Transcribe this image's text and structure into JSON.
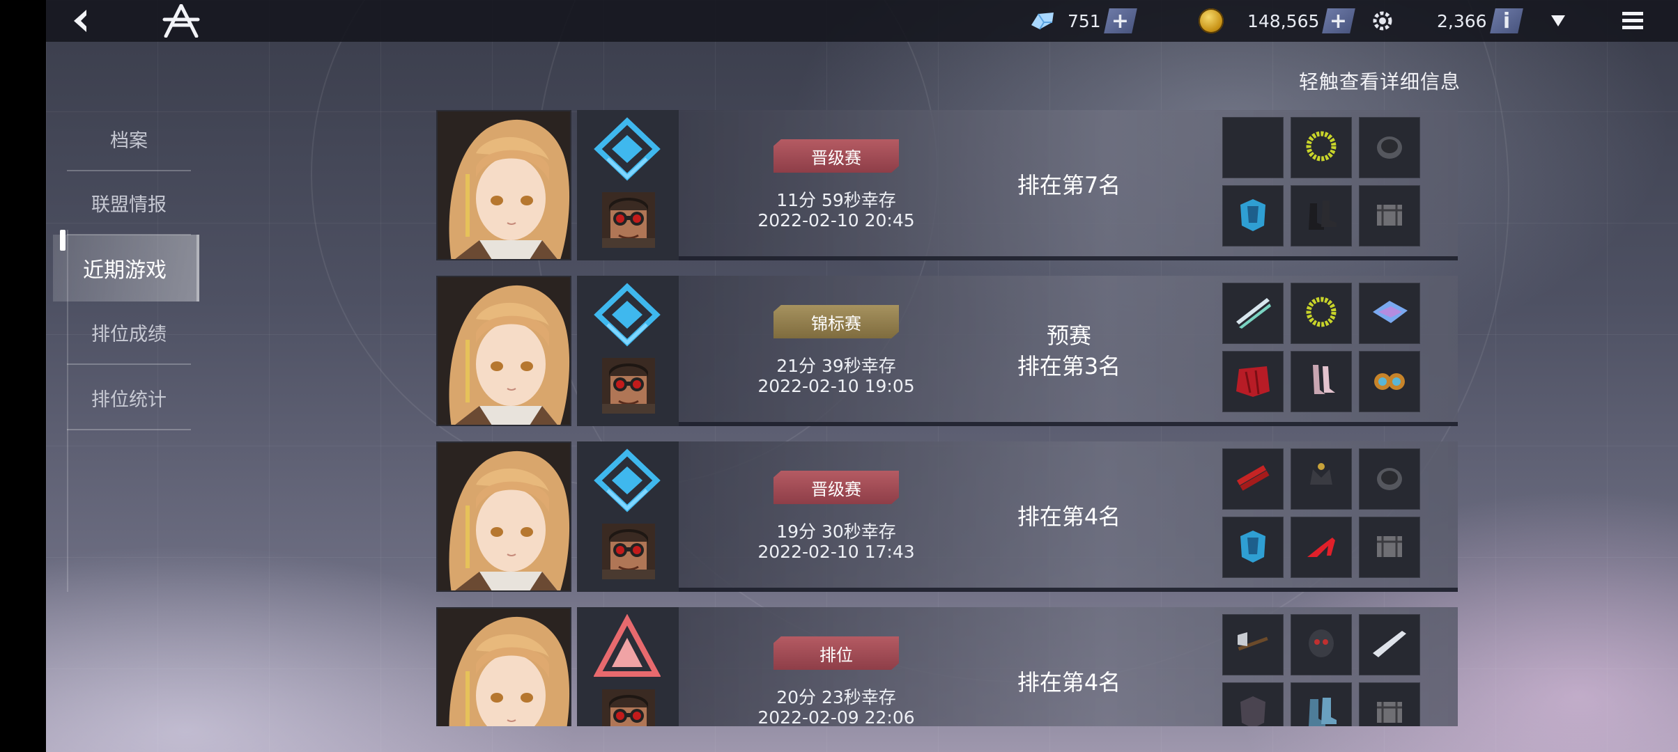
{
  "topbar": {
    "gems": "751",
    "coins": "148,565",
    "points": "2,366",
    "plus_glyph": "+",
    "info_glyph": "i"
  },
  "hint": "轻触查看详细信息",
  "sidebar": {
    "items": [
      {
        "label": "档案"
      },
      {
        "label": "联盟情报"
      },
      {
        "label": "近期游戏"
      },
      {
        "label": "排位成绩"
      },
      {
        "label": "排位统计"
      }
    ]
  },
  "games": [
    {
      "mode": "晋级赛",
      "mode_style": "red",
      "tier": "diamond",
      "survive": "11分 59秒幸存",
      "date": "2022-02-10 20:45",
      "rank_line1": "",
      "rank_line2": "排在第7名",
      "items": [
        "empty",
        "ring",
        "helmet-dark",
        "armor-blue",
        "boots-dark",
        "chest-gray"
      ]
    },
    {
      "mode": "锦标赛",
      "mode_style": "gold",
      "tier": "diamond",
      "survive": "21分 39秒幸存",
      "date": "2022-02-10 19:05",
      "rank_line1": "预赛",
      "rank_line2": "排在第3名",
      "items": [
        "dual-blades",
        "ring",
        "wing-blade",
        "cape-red",
        "boots-pink",
        "goggles-gold"
      ]
    },
    {
      "mode": "晋级赛",
      "mode_style": "red",
      "tier": "diamond",
      "survive": "19分 30秒幸存",
      "date": "2022-02-10 17:43",
      "rank_line1": "",
      "rank_line2": "排在第4名",
      "items": [
        "dynamite",
        "crown-dark",
        "helmet-dark",
        "armor-blue",
        "heels-red",
        "chest-gray"
      ]
    },
    {
      "mode": "排位",
      "mode_style": "red",
      "tier": "triangle",
      "survive": "20分 23秒幸存",
      "date": "2022-02-09 22:06",
      "rank_line1": "",
      "rank_line2": "排在第4名",
      "items": [
        "axe",
        "helmet-skull",
        "blade-silver",
        "armor-dark",
        "boots-blue",
        "chest-gray"
      ]
    }
  ],
  "colors": {
    "tag_red": "#a04b55",
    "tag_gold": "#947f4d",
    "tier_blue": "#3fb8ee",
    "tier_pink": "#e86a6e"
  }
}
